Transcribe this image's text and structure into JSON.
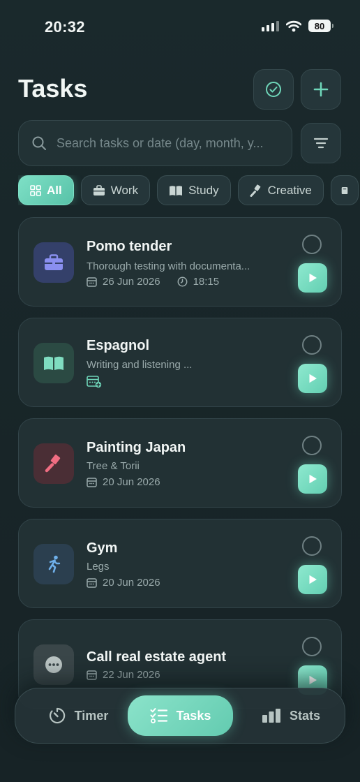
{
  "status_bar": {
    "time": "20:32",
    "battery": "80"
  },
  "header": {
    "title": "Tasks"
  },
  "search": {
    "placeholder": "Search tasks or date (day, month, y..."
  },
  "chips": [
    {
      "label": "All",
      "icon": "grid-icon",
      "active": true
    },
    {
      "label": "Work",
      "icon": "briefcase-icon",
      "active": false
    },
    {
      "label": "Study",
      "icon": "book-icon",
      "active": false
    },
    {
      "label": "Creative",
      "icon": "brush-icon",
      "active": false
    },
    {
      "label": "",
      "icon": "notebook-icon",
      "active": false
    }
  ],
  "tasks": [
    {
      "title": "Pomo tender",
      "description": "Thorough testing with documenta...",
      "date": "26 Jun 2026",
      "time": "18:15",
      "icon": "briefcase-icon",
      "icon_bg": "#34406a",
      "icon_color": "#8a8ff0"
    },
    {
      "title": "Espagnol",
      "description": "Writing and listening ...",
      "date": "",
      "time": "",
      "icon": "book-open-icon",
      "icon_bg": "#2b4a43",
      "icon_color": "#7fdcc0"
    },
    {
      "title": "Painting Japan",
      "description": "Tree & Torii",
      "date": "20 Jun 2026",
      "time": "",
      "icon": "brush-icon",
      "icon_bg": "#4a2e35",
      "icon_color": "#f06d82"
    },
    {
      "title": "Gym",
      "description": "Legs",
      "date": "20 Jun 2026",
      "time": "",
      "icon": "running-icon",
      "icon_bg": "#2b3f4f",
      "icon_color": "#6fb0ea"
    },
    {
      "title": "Call real estate agent",
      "description": "",
      "date": "22 Jun 2026",
      "time": "",
      "icon": "more-icon",
      "icon_bg": "#3a4649",
      "icon_color": "#b9c3c2"
    }
  ],
  "nav": {
    "timer": "Timer",
    "tasks": "Tasks",
    "stats": "Stats"
  },
  "colors": {
    "accent": "#6fd6b9",
    "background": "#19272a",
    "card": "#223134"
  }
}
